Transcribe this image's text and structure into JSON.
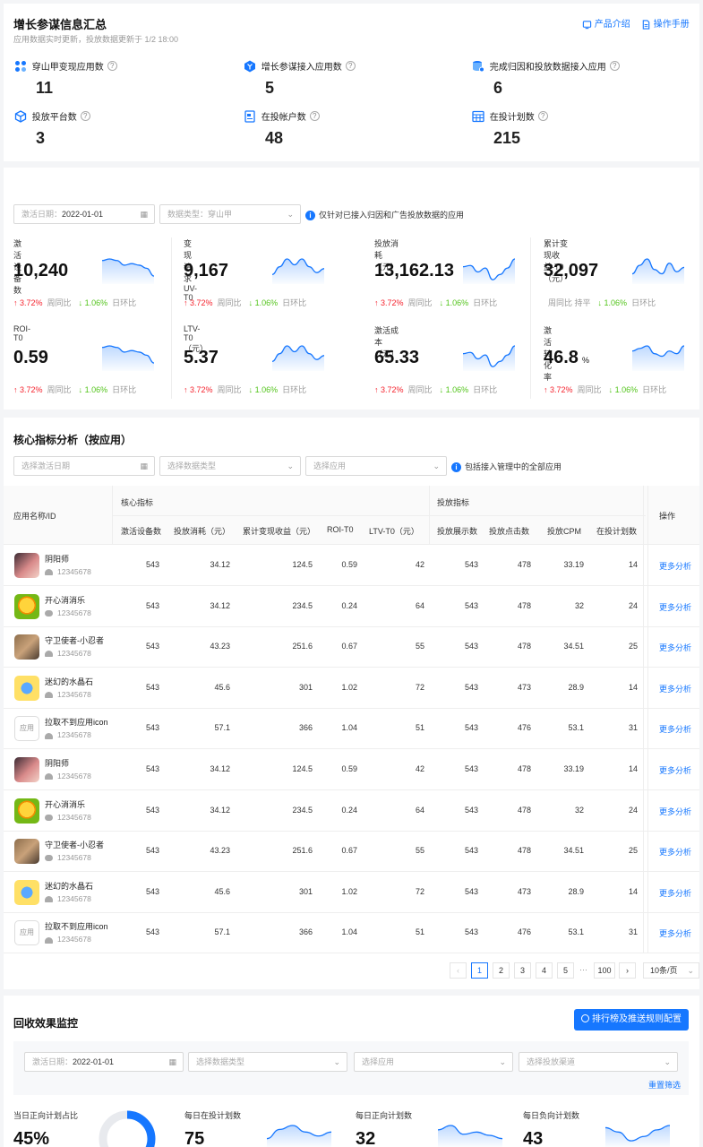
{
  "summary": {
    "title": "增长参谋信息汇总",
    "subtitle": "应用数据实时更新，投放数据更新于 1/2 18:00",
    "links": [
      "产品介绍",
      "操作手册"
    ],
    "stats": [
      {
        "label": "穿山甲变现应用数",
        "value": "11",
        "icon": "apps-icon"
      },
      {
        "label": "增长参谋接入应用数",
        "value": "5",
        "icon": "hexagon-y-icon"
      },
      {
        "label": "完成归因和投放数据接入应用",
        "value": "6",
        "icon": "database-icon"
      },
      {
        "label": "投放平台数",
        "value": "3",
        "icon": "cube-icon"
      },
      {
        "label": "在投帐户数",
        "value": "48",
        "icon": "account-icon"
      },
      {
        "label": "在投计划数",
        "value": "215",
        "icon": "table-icon"
      }
    ]
  },
  "overview": {
    "date_label": "激活日期：",
    "date_value": "2022-01-01",
    "datatype_label": "数据类型：",
    "datatype_value": "穿山甲",
    "note": "仅针对已接入归因和广告投放数据的应用",
    "metrics": [
      {
        "label": "激活设备数",
        "value": "10,240",
        "unit": "",
        "wow": "3.72%",
        "wow_label": "周同比",
        "dod": "1.06%",
        "dod_label": "日环比",
        "spark": [
          14,
          15,
          14,
          11,
          12,
          11,
          9,
          4
        ]
      },
      {
        "label": "变现请求UV-T0",
        "value": "9,167",
        "unit": "",
        "wow": "3.72%",
        "wow_label": "周同比",
        "dod": "1.06%",
        "dod_label": "日环比",
        "spark": [
          4,
          8,
          12,
          9,
          12,
          8,
          5,
          7
        ]
      },
      {
        "label": "投放消耗（元）",
        "value": "13,162.13",
        "unit": "",
        "wow": "3.72%",
        "wow_label": "周同比",
        "dod": "1.06%",
        "dod_label": "日环比",
        "spark": [
          12,
          13,
          8,
          11,
          2,
          6,
          11,
          18
        ]
      },
      {
        "label": "累计变现收益-T0（元）",
        "value": "32,097",
        "unit": "",
        "wow": "",
        "wow_label": "周同比 持平",
        "dod": "1.06%",
        "dod_label": "日环比",
        "spark": [
          4,
          8,
          11,
          6,
          4,
          9,
          5,
          7
        ]
      },
      {
        "label": "ROI-T0",
        "value": "0.59",
        "unit": "",
        "wow": "3.72%",
        "wow_label": "周同比",
        "dod": "1.06%",
        "dod_label": "日环比",
        "spark": [
          14,
          15,
          14,
          11,
          12,
          11,
          9,
          4
        ]
      },
      {
        "label": "LTV-T0（元）",
        "value": "5.37",
        "unit": "",
        "wow": "3.72%",
        "wow_label": "周同比",
        "dod": "1.06%",
        "dod_label": "日环比",
        "spark": [
          4,
          8,
          12,
          9,
          12,
          8,
          5,
          7
        ]
      },
      {
        "label": "激活成本（元）",
        "value": "65.33",
        "unit": "",
        "wow": "3.72%",
        "wow_label": "周同比",
        "dod": "1.06%",
        "dod_label": "日环比",
        "spark": [
          12,
          13,
          8,
          11,
          2,
          6,
          11,
          18
        ]
      },
      {
        "label": "激活转化率",
        "value": "46.8",
        "unit": "%",
        "wow": "3.72%",
        "wow_label": "周同比",
        "dod": "1.06%",
        "dod_label": "日环比",
        "spark": [
          7,
          8,
          9,
          6,
          5,
          7,
          6,
          9
        ]
      }
    ]
  },
  "core": {
    "title": "核心指标分析（按应用）",
    "date_placeholder": "选择激活日期",
    "datatype_placeholder": "选择数据类型",
    "app_placeholder": "选择应用",
    "note": "包括接入管理中的全部应用",
    "group_core": "核心指标",
    "group_ad": "投放指标",
    "col_app": "应用名称/ID",
    "col_action": "操作",
    "columns": [
      "激活设备数",
      "投放消耗（元）",
      "累计变现收益（元）",
      "ROI-T0",
      "LTV-T0（元）",
      "投放展示数",
      "投放点击数",
      "投放CPM",
      "在投计划数"
    ],
    "action_label": "更多分析",
    "rows": [
      {
        "name": "阴阳师",
        "id": "12345678",
        "platform": "android",
        "icon": "onmyoji",
        "cells": [
          "543",
          "34.12",
          "124.5",
          "0.59",
          "42",
          "543",
          "478",
          "33.19",
          "14"
        ]
      },
      {
        "name": "开心消消乐",
        "id": "12345678",
        "platform": "apple",
        "icon": "chick",
        "cells": [
          "543",
          "34.12",
          "234.5",
          "0.24",
          "64",
          "543",
          "478",
          "32",
          "24"
        ]
      },
      {
        "name": "守卫使者-小忍者",
        "id": "12345678",
        "platform": "android",
        "icon": "ninja",
        "cells": [
          "543",
          "43.23",
          "251.6",
          "0.67",
          "55",
          "543",
          "478",
          "34.51",
          "25"
        ]
      },
      {
        "name": "迷幻的水晶石",
        "id": "12345678",
        "platform": "android",
        "icon": "crystal",
        "cells": [
          "543",
          "45.6",
          "301",
          "1.02",
          "72",
          "543",
          "473",
          "28.9",
          "14"
        ]
      },
      {
        "name": "拉取不到应用icon",
        "id": "12345678",
        "platform": "android",
        "icon": "placeholder",
        "cells": [
          "543",
          "57.1",
          "366",
          "1.04",
          "51",
          "543",
          "476",
          "53.1",
          "31"
        ]
      },
      {
        "name": "阴阳师",
        "id": "12345678",
        "platform": "android",
        "icon": "onmyoji",
        "cells": [
          "543",
          "34.12",
          "124.5",
          "0.59",
          "42",
          "543",
          "478",
          "33.19",
          "14"
        ]
      },
      {
        "name": "开心消消乐",
        "id": "12345678",
        "platform": "apple",
        "icon": "chick",
        "cells": [
          "543",
          "34.12",
          "234.5",
          "0.24",
          "64",
          "543",
          "478",
          "32",
          "24"
        ]
      },
      {
        "name": "守卫使者-小忍者",
        "id": "12345678",
        "platform": "apple",
        "icon": "ninja",
        "cells": [
          "543",
          "43.23",
          "251.6",
          "0.67",
          "55",
          "543",
          "478",
          "34.51",
          "25"
        ]
      },
      {
        "name": "迷幻的水晶石",
        "id": "12345678",
        "platform": "android",
        "icon": "crystal",
        "cells": [
          "543",
          "45.6",
          "301",
          "1.02",
          "72",
          "543",
          "473",
          "28.9",
          "14"
        ]
      },
      {
        "name": "拉取不到应用icon",
        "id": "12345678",
        "platform": "android",
        "icon": "placeholder",
        "cells": [
          "543",
          "57.1",
          "366",
          "1.04",
          "51",
          "543",
          "476",
          "53.1",
          "31"
        ]
      }
    ],
    "placeholder_icon_text": "应用",
    "pagination": {
      "prev": "‹",
      "pages": [
        "1",
        "2",
        "3",
        "4",
        "5"
      ],
      "ellipsis": "···",
      "last": "100",
      "next": "›",
      "current": "1",
      "page_size": "10条/页"
    }
  },
  "recovery": {
    "title": "回收效果监控",
    "button": "排行榜及推送规则配置",
    "date_label": "激活日期：",
    "date_value": "2022-01-01",
    "datatype_placeholder": "选择数据类型",
    "app_placeholder": "选择应用",
    "channel_placeholder": "选择投放渠道",
    "reset": "重置筛选",
    "metrics": [
      {
        "label": "当日正向计划占比",
        "value": "45%",
        "donut_fraction": 0.45
      },
      {
        "label": "每日在投计划数",
        "value": "75",
        "spark": [
          5,
          12,
          15,
          10,
          7,
          10
        ]
      },
      {
        "label": "每日正向计划数",
        "value": "32",
        "spark": [
          14,
          18,
          10,
          12,
          9,
          6
        ]
      },
      {
        "label": "每日负向计划数",
        "value": "43",
        "spark": [
          16,
          12,
          4,
          8,
          14,
          18
        ]
      }
    ]
  },
  "colors": {
    "primary": "#1677ff",
    "up": "#f5222d",
    "down": "#52c41a"
  }
}
